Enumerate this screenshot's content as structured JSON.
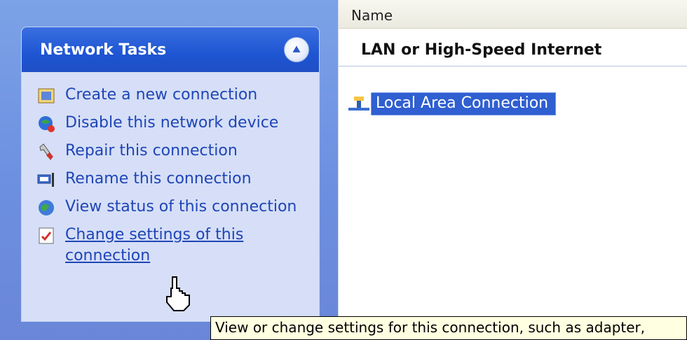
{
  "tasks": {
    "title": "Network Tasks",
    "items": [
      {
        "label": "Create a new connection",
        "icon": "new-connection-icon"
      },
      {
        "label": "Disable this network device",
        "icon": "disable-device-icon"
      },
      {
        "label": "Repair this connection",
        "icon": "repair-wrench-icon"
      },
      {
        "label": "Rename this connection",
        "icon": "rename-icon"
      },
      {
        "label": "View status of this connection",
        "icon": "status-globe-icon"
      },
      {
        "label": "Change settings of this connection",
        "icon": "settings-check-icon"
      }
    ]
  },
  "list": {
    "column_name": "Name",
    "group": "LAN or High-Speed Internet",
    "item": "Local Area Connection"
  },
  "tooltip": "View or change settings for this connection, such as adapter,"
}
